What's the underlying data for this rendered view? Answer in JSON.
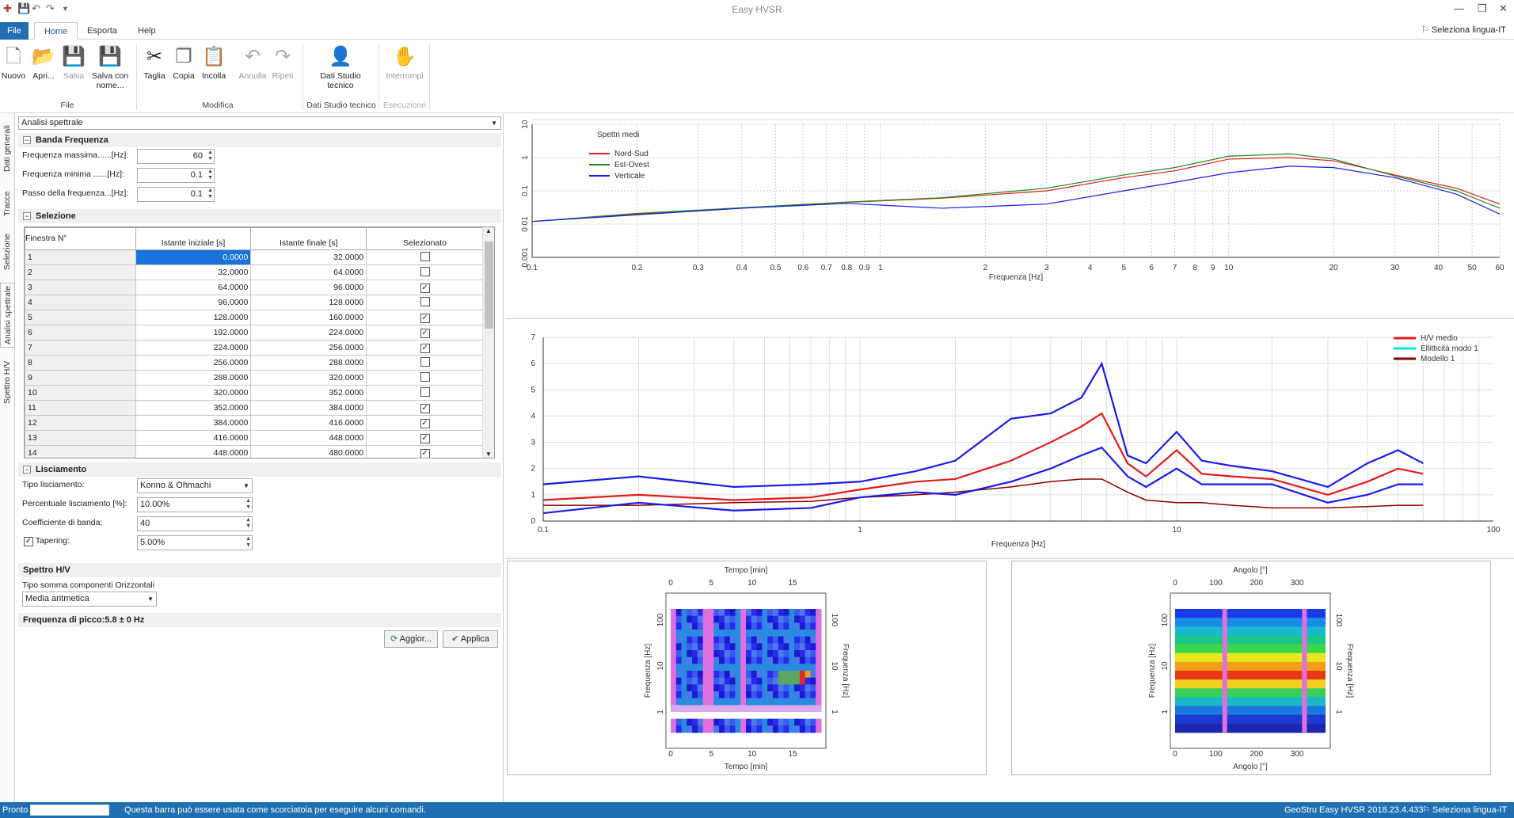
{
  "app": {
    "title": "Easy HVSR",
    "qa_save": "💾",
    "qa_undo": "↶",
    "qa_redo": "↷"
  },
  "tabs": {
    "file": "File",
    "home": "Home",
    "esporta": "Esporta",
    "help": "Help",
    "lang": "Seleziona lingua-IT"
  },
  "ribbon": {
    "nuovo": "Nuovo",
    "apri": "Apri...",
    "salva": "Salva",
    "salva_con_nome": "Salva con nome...",
    "taglia": "Taglia",
    "copia": "Copia",
    "incolla": "Incolla",
    "annulla": "Annulla",
    "ripeti": "Ripeti",
    "dati_studio": "Dati Studio tecnico",
    "interrompi": "Interrompi",
    "g_file": "File",
    "g_modifica": "Modifica",
    "g_dati": "Dati Studio tecnico",
    "g_esecuzione": "Esecuzione"
  },
  "left_tabs": [
    "Dati generali",
    "Tracce",
    "Selezione",
    "Analisi spettrale",
    "Spettro H/V"
  ],
  "panel": {
    "mode": "Analisi spettrale",
    "banda": {
      "title": "Banda Frequenza",
      "fmax_label": "Frequenza massima......[Hz]:",
      "fmax": "60",
      "fmin_label": "Frequenza minima ......[Hz]:",
      "fmin": "0.1",
      "passo_label": "Passo della frequenza...[Hz]:",
      "passo": "0.1"
    },
    "selezione": {
      "title": "Selezione",
      "headers": [
        "Finestra N°",
        "Istante iniziale [s]",
        "Istante finale [s]",
        "Selezionato"
      ],
      "rows": [
        {
          "n": "1",
          "start": "0.0000",
          "end": "32.0000",
          "sel": false
        },
        {
          "n": "2",
          "start": "32.0000",
          "end": "64.0000",
          "sel": false
        },
        {
          "n": "3",
          "start": "64.0000",
          "end": "96.0000",
          "sel": true
        },
        {
          "n": "4",
          "start": "96.0000",
          "end": "128.0000",
          "sel": false
        },
        {
          "n": "5",
          "start": "128.0000",
          "end": "160.0000",
          "sel": true
        },
        {
          "n": "6",
          "start": "192.0000",
          "end": "224.0000",
          "sel": true
        },
        {
          "n": "7",
          "start": "224.0000",
          "end": "256.0000",
          "sel": true
        },
        {
          "n": "8",
          "start": "256.0000",
          "end": "288.0000",
          "sel": false
        },
        {
          "n": "9",
          "start": "288.0000",
          "end": "320.0000",
          "sel": false
        },
        {
          "n": "10",
          "start": "320.0000",
          "end": "352.0000",
          "sel": false
        },
        {
          "n": "11",
          "start": "352.0000",
          "end": "384.0000",
          "sel": true
        },
        {
          "n": "12",
          "start": "384.0000",
          "end": "416.0000",
          "sel": true
        },
        {
          "n": "13",
          "start": "416.0000",
          "end": "448.0000",
          "sel": true
        },
        {
          "n": "14",
          "start": "448.0000",
          "end": "480.0000",
          "sel": true
        }
      ]
    },
    "lisciamento": {
      "title": "Lisciamento",
      "tipo_label": "Tipo lisciamento:",
      "tipo": "Konno & Ohmachi",
      "perc_label": "Percentuale lisciamento [%]:",
      "perc": "10.00%",
      "coef_label": "Coefficiente di banda:",
      "coef": "40",
      "taper_label": "Tapering:",
      "taper": "5.00%"
    },
    "spettro": {
      "title": "Spettro H/V",
      "tipo_label": "Tipo somma componenti Orizzontali",
      "tipo": "Media aritmetica"
    },
    "picco": "Frequenza di picco:5.8 ± 0 Hz",
    "aggiorna": "Aggior...",
    "applica": "Applica"
  },
  "chart1": {
    "legend_title": "Spettri medi",
    "series": [
      "Nord-Sud",
      "Est-Ovest",
      "Verticale"
    ],
    "xlabel": "Frequenza [Hz]",
    "xticks": [
      "0.1",
      "0.2",
      "0.3",
      "0.4",
      "0.5",
      "0.6",
      "0.7",
      "0.8",
      "0.9",
      "1",
      "2",
      "3",
      "4",
      "5",
      "6",
      "7",
      "8",
      "9",
      "10",
      "20",
      "30",
      "40",
      "50",
      "60"
    ],
    "yticks": [
      "0.001",
      "0.01",
      "0.1",
      "1",
      "10"
    ]
  },
  "chart2": {
    "series": [
      "H/V medio",
      "Ellitticità modo  1",
      "Modello 1"
    ],
    "xlabel": "Frequenza [Hz]",
    "xticks": [
      "0.1",
      "1",
      "10",
      "100"
    ],
    "yticks": [
      "0",
      "1",
      "2",
      "3",
      "4",
      "5",
      "6",
      "7"
    ]
  },
  "chart3": {
    "top_label": "Tempo [min]",
    "bottom_label": "Tempo [min]",
    "ylabel": "Frequenza [Hz]",
    "ticks": [
      "0",
      "5",
      "10",
      "15"
    ],
    "yticks": [
      "100",
      "10",
      "1"
    ]
  },
  "chart4": {
    "top_label": "Angolo [°]",
    "bottom_label": "Angolo [°]",
    "ylabel": "Frequenza [Hz]",
    "ticks": [
      "0",
      "100",
      "200",
      "300"
    ],
    "yticks": [
      "100",
      "10",
      "1"
    ]
  },
  "chart_data": [
    {
      "type": "line",
      "xscale": "log",
      "yscale": "log",
      "xlabel": "Frequenza [Hz]",
      "xlim": [
        0.1,
        60
      ],
      "ylim": [
        0.001,
        10
      ],
      "legend": "top-left",
      "x": [
        0.1,
        0.2,
        0.4,
        0.8,
        1.5,
        3,
        5,
        7,
        10,
        15,
        20,
        30,
        45,
        60
      ],
      "series": [
        {
          "name": "Nord-Sud",
          "color": "#e41a1c",
          "values": [
            0.012,
            0.02,
            0.03,
            0.045,
            0.06,
            0.1,
            0.25,
            0.4,
            0.9,
            1.0,
            0.8,
            0.3,
            0.12,
            0.04
          ]
        },
        {
          "name": "Est-Ovest",
          "color": "#1a8a1a",
          "values": [
            0.012,
            0.021,
            0.031,
            0.046,
            0.062,
            0.12,
            0.3,
            0.5,
            1.1,
            1.3,
            0.9,
            0.28,
            0.1,
            0.03
          ]
        },
        {
          "name": "Verticale",
          "color": "#1a1aee",
          "values": [
            0.012,
            0.019,
            0.03,
            0.042,
            0.03,
            0.04,
            0.1,
            0.18,
            0.35,
            0.55,
            0.5,
            0.25,
            0.08,
            0.02
          ]
        }
      ]
    },
    {
      "type": "line",
      "xscale": "log",
      "xlabel": "Frequenza [Hz]",
      "xlim": [
        0.1,
        100
      ],
      "ylim": [
        0,
        7
      ],
      "legend": "top-right",
      "x": [
        0.1,
        0.2,
        0.4,
        0.7,
        1,
        1.5,
        2,
        3,
        4,
        5,
        5.8,
        7,
        8,
        10,
        12,
        15,
        20,
        30,
        40,
        50,
        60
      ],
      "series": [
        {
          "name": "H/V medio",
          "color": "#e41a1c",
          "values": [
            0.8,
            1.0,
            0.8,
            0.9,
            1.2,
            1.5,
            1.6,
            2.3,
            3.0,
            3.6,
            4.1,
            2.2,
            1.7,
            2.7,
            1.8,
            1.7,
            1.6,
            1.0,
            1.5,
            2.0,
            1.8
          ]
        },
        {
          "name": "Ellitticità modo  1",
          "color": "#00e5ee",
          "values": []
        },
        {
          "name": "Modello 1",
          "color": "#8b0000",
          "values": [
            0.6,
            0.6,
            0.7,
            0.75,
            0.9,
            1.0,
            1.1,
            1.3,
            1.5,
            1.6,
            1.6,
            1.1,
            0.8,
            0.7,
            0.7,
            0.6,
            0.5,
            0.5,
            0.55,
            0.6,
            0.6
          ]
        },
        {
          "name": "",
          "color": "#1a1aee",
          "values": [
            1.4,
            1.7,
            1.3,
            1.4,
            1.5,
            1.9,
            2.3,
            3.9,
            4.1,
            4.7,
            6.0,
            2.5,
            2.2,
            3.4,
            2.3,
            2.1,
            1.9,
            1.3,
            2.2,
            2.7,
            2.2
          ]
        },
        {
          "name": "",
          "color": "#1a1aee",
          "values": [
            0.3,
            0.7,
            0.4,
            0.5,
            0.9,
            1.1,
            1.0,
            1.5,
            2.0,
            2.5,
            2.8,
            1.7,
            1.3,
            2.0,
            1.4,
            1.4,
            1.4,
            0.7,
            1.0,
            1.4,
            1.4
          ]
        }
      ]
    }
  ],
  "status": {
    "left": "Pronto",
    "hint": "Questa barra può essere usata come scorciatoia per eseguire alcuni comandi.",
    "version": "GeoStru Easy HVSR 2018.23.4.433",
    "lang": "Seleziona lingua-IT"
  }
}
